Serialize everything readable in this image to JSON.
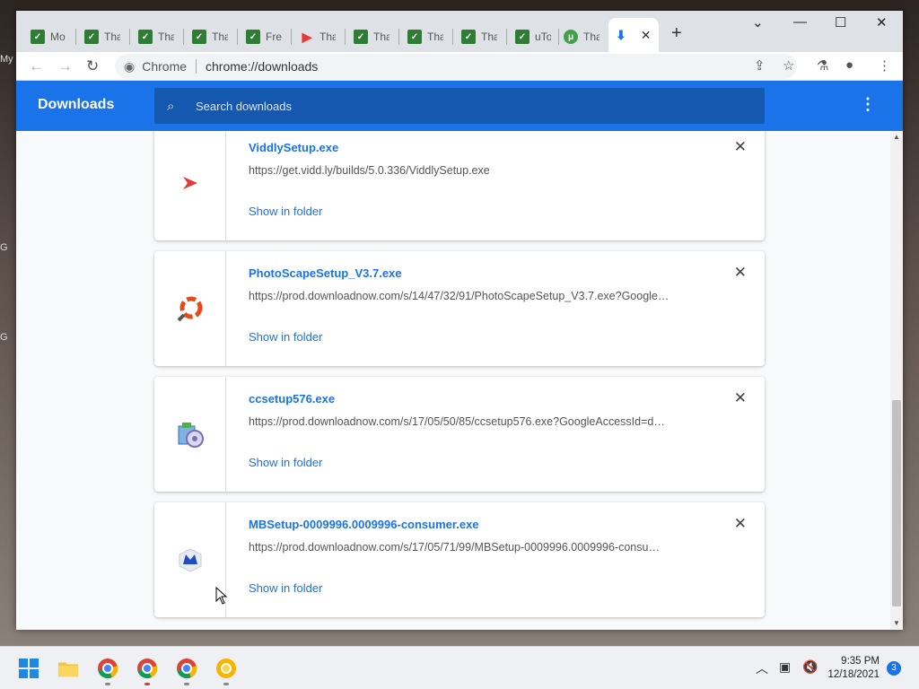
{
  "desktop": {
    "labels": [
      "My",
      "G",
      "G"
    ]
  },
  "browser": {
    "tabs": [
      {
        "icon": "ytt-icon",
        "label": "Mo"
      },
      {
        "icon": "ytt-icon",
        "label": "Tha"
      },
      {
        "icon": "ytt-icon",
        "label": "Tha"
      },
      {
        "icon": "ytt-icon",
        "label": "Tha"
      },
      {
        "icon": "ytt-icon",
        "label": "Fre"
      },
      {
        "icon": "viddly-icon",
        "label": "Tha"
      },
      {
        "icon": "ytt-icon",
        "label": "Tha"
      },
      {
        "icon": "ytt-icon",
        "label": "Tha"
      },
      {
        "icon": "ytt-icon",
        "label": "Tha"
      },
      {
        "icon": "ytt-icon",
        "label": "uTo"
      },
      {
        "icon": "utorrent-icon",
        "label": "Tha"
      }
    ],
    "omnibox": {
      "site": "Chrome",
      "url": "chrome://downloads"
    }
  },
  "downloads": {
    "title": "Downloads",
    "search_placeholder": "Search downloads",
    "items": [
      {
        "name": "ViddlySetup.exe",
        "url": "https://get.vidd.ly/builds/5.0.336/ViddlySetup.exe",
        "action": "Show in folder",
        "icon": "viddly-icon"
      },
      {
        "name": "PhotoScapeSetup_V3.7.exe",
        "url": "https://prod.downloadnow.com/s/14/47/32/91/PhotoScapeSetup_V3.7.exe?Google…",
        "action": "Show in folder",
        "icon": "photoscape-icon"
      },
      {
        "name": "ccsetup576.exe",
        "url": "https://prod.downloadnow.com/s/17/05/50/85/ccsetup576.exe?GoogleAccessId=d…",
        "action": "Show in folder",
        "icon": "ccleaner-icon"
      },
      {
        "name": "MBSetup-0009996.0009996-consumer.exe",
        "url": "https://prod.downloadnow.com/s/17/05/71/99/MBSetup-0009996.0009996-consu…",
        "action": "Show in folder",
        "icon": "malwarebytes-icon"
      }
    ]
  },
  "taskbar": {
    "time": "9:35 PM",
    "date": "12/18/2021",
    "notifications": "3"
  },
  "colors": {
    "accent": "#1a73e8",
    "header": "#1a73e8"
  }
}
